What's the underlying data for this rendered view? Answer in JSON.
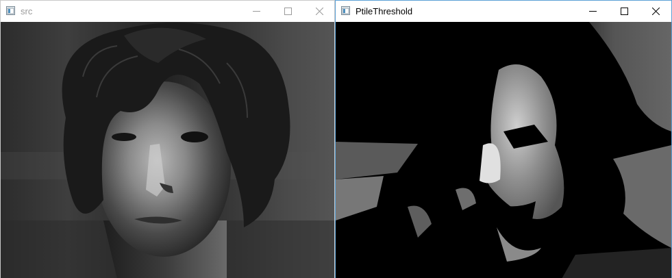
{
  "windows": [
    {
      "title": "src",
      "active": false,
      "controls": {
        "minimize": "minimize-icon",
        "maximize": "maximize-icon",
        "close": "close-icon"
      },
      "content": "grayscale portrait photo"
    },
    {
      "title": "PtileThreshold",
      "active": true,
      "controls": {
        "minimize": "minimize-icon",
        "maximize": "maximize-icon",
        "close": "close-icon"
      },
      "content": "thresholded portrait image"
    }
  ],
  "colors": {
    "inactive_title": "#9a9a9a",
    "active_title": "#000000",
    "active_border": "#5aa0d6",
    "titlebar_bg": "#ffffff"
  }
}
